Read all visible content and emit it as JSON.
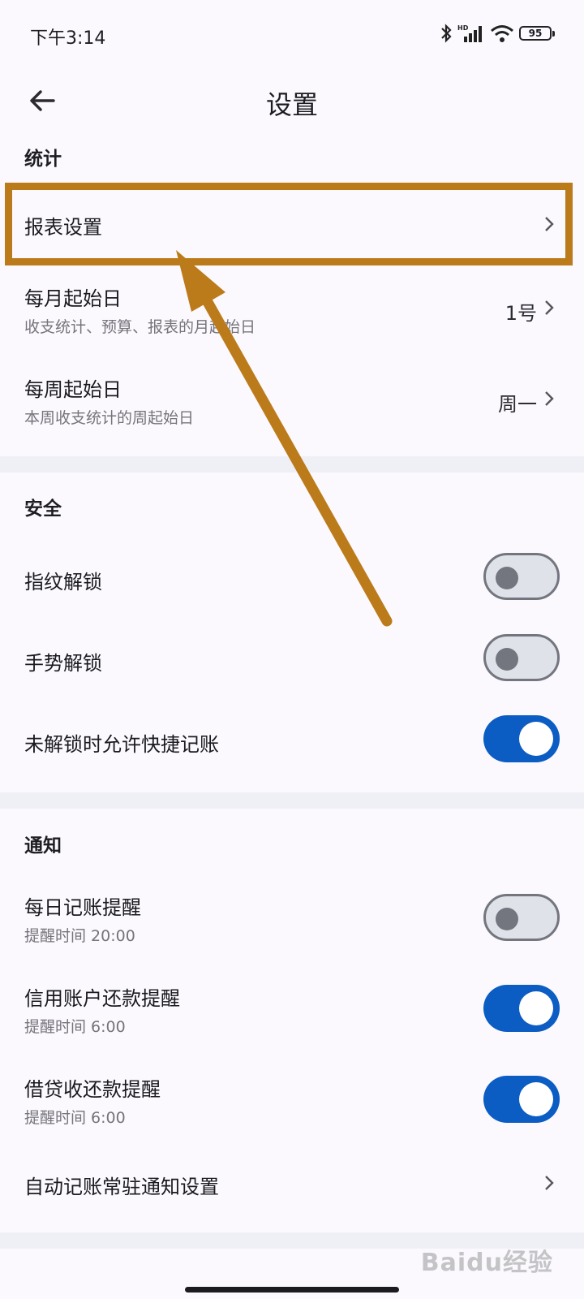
{
  "status_bar": {
    "time": "下午3:14",
    "battery": "95"
  },
  "app_bar": {
    "title": "设置"
  },
  "sections": {
    "stats": {
      "header": "统计",
      "report_settings": {
        "label": "报表设置"
      },
      "month_start": {
        "label": "每月起始日",
        "sub": "收支统计、预算、报表的月起始日",
        "value": "1号"
      },
      "week_start": {
        "label": "每周起始日",
        "sub": "本周收支统计的周起始日",
        "value": "周一"
      }
    },
    "security": {
      "header": "安全",
      "fingerprint": {
        "label": "指纹解锁",
        "enabled": false
      },
      "gesture": {
        "label": "手势解锁",
        "enabled": false
      },
      "quick_record": {
        "label": "未解锁时允许快捷记账",
        "enabled": true
      }
    },
    "notify": {
      "header": "通知",
      "daily": {
        "label": "每日记账提醒",
        "sub": "提醒时间 20:00",
        "enabled": false
      },
      "credit": {
        "label": "信用账户还款提醒",
        "sub": "提醒时间 6:00",
        "enabled": true
      },
      "loan": {
        "label": "借贷收还款提醒",
        "sub": "提醒时间 6:00",
        "enabled": true
      },
      "auto_notify": {
        "label": "自动记账常驻通知设置"
      }
    }
  },
  "colors": {
    "accent": "#0b5cc3",
    "annotation": "#bc7b1a"
  },
  "watermark": "Baidu经验"
}
